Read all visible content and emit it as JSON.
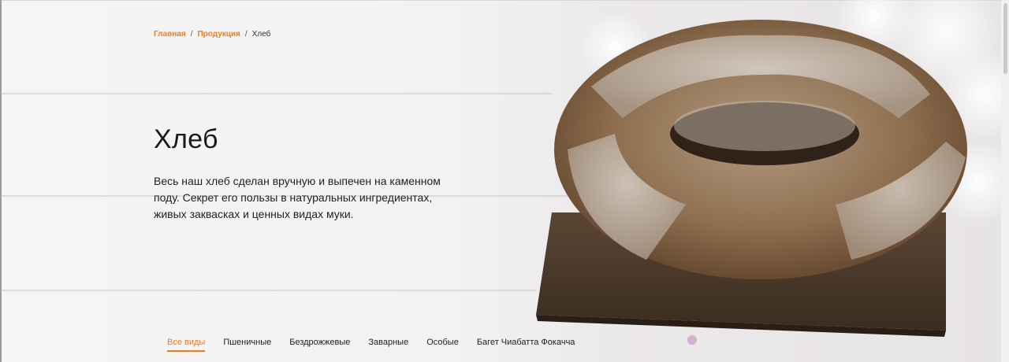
{
  "breadcrumb": {
    "home": "Главная",
    "products": "Продукция",
    "separator": "/",
    "current": "Хлеб"
  },
  "hero": {
    "title": "Хлеб",
    "description": "Весь наш хлеб сделан вручную и выпечен на каменном поду. Секрет его пользы в натуральных ингредиентах, живых заквасках и ценных видах муки."
  },
  "tabs": [
    {
      "label": "Все виды",
      "active": true
    },
    {
      "label": "Пшеничные",
      "active": false
    },
    {
      "label": "Бездрожжевые",
      "active": false
    },
    {
      "label": "Заварные",
      "active": false
    },
    {
      "label": "Особые",
      "active": false
    },
    {
      "label": "Багет Чиабатта Фокачча",
      "active": false
    }
  ],
  "colors": {
    "accent": "#ef7d1b",
    "text": "#1a1a1a"
  }
}
